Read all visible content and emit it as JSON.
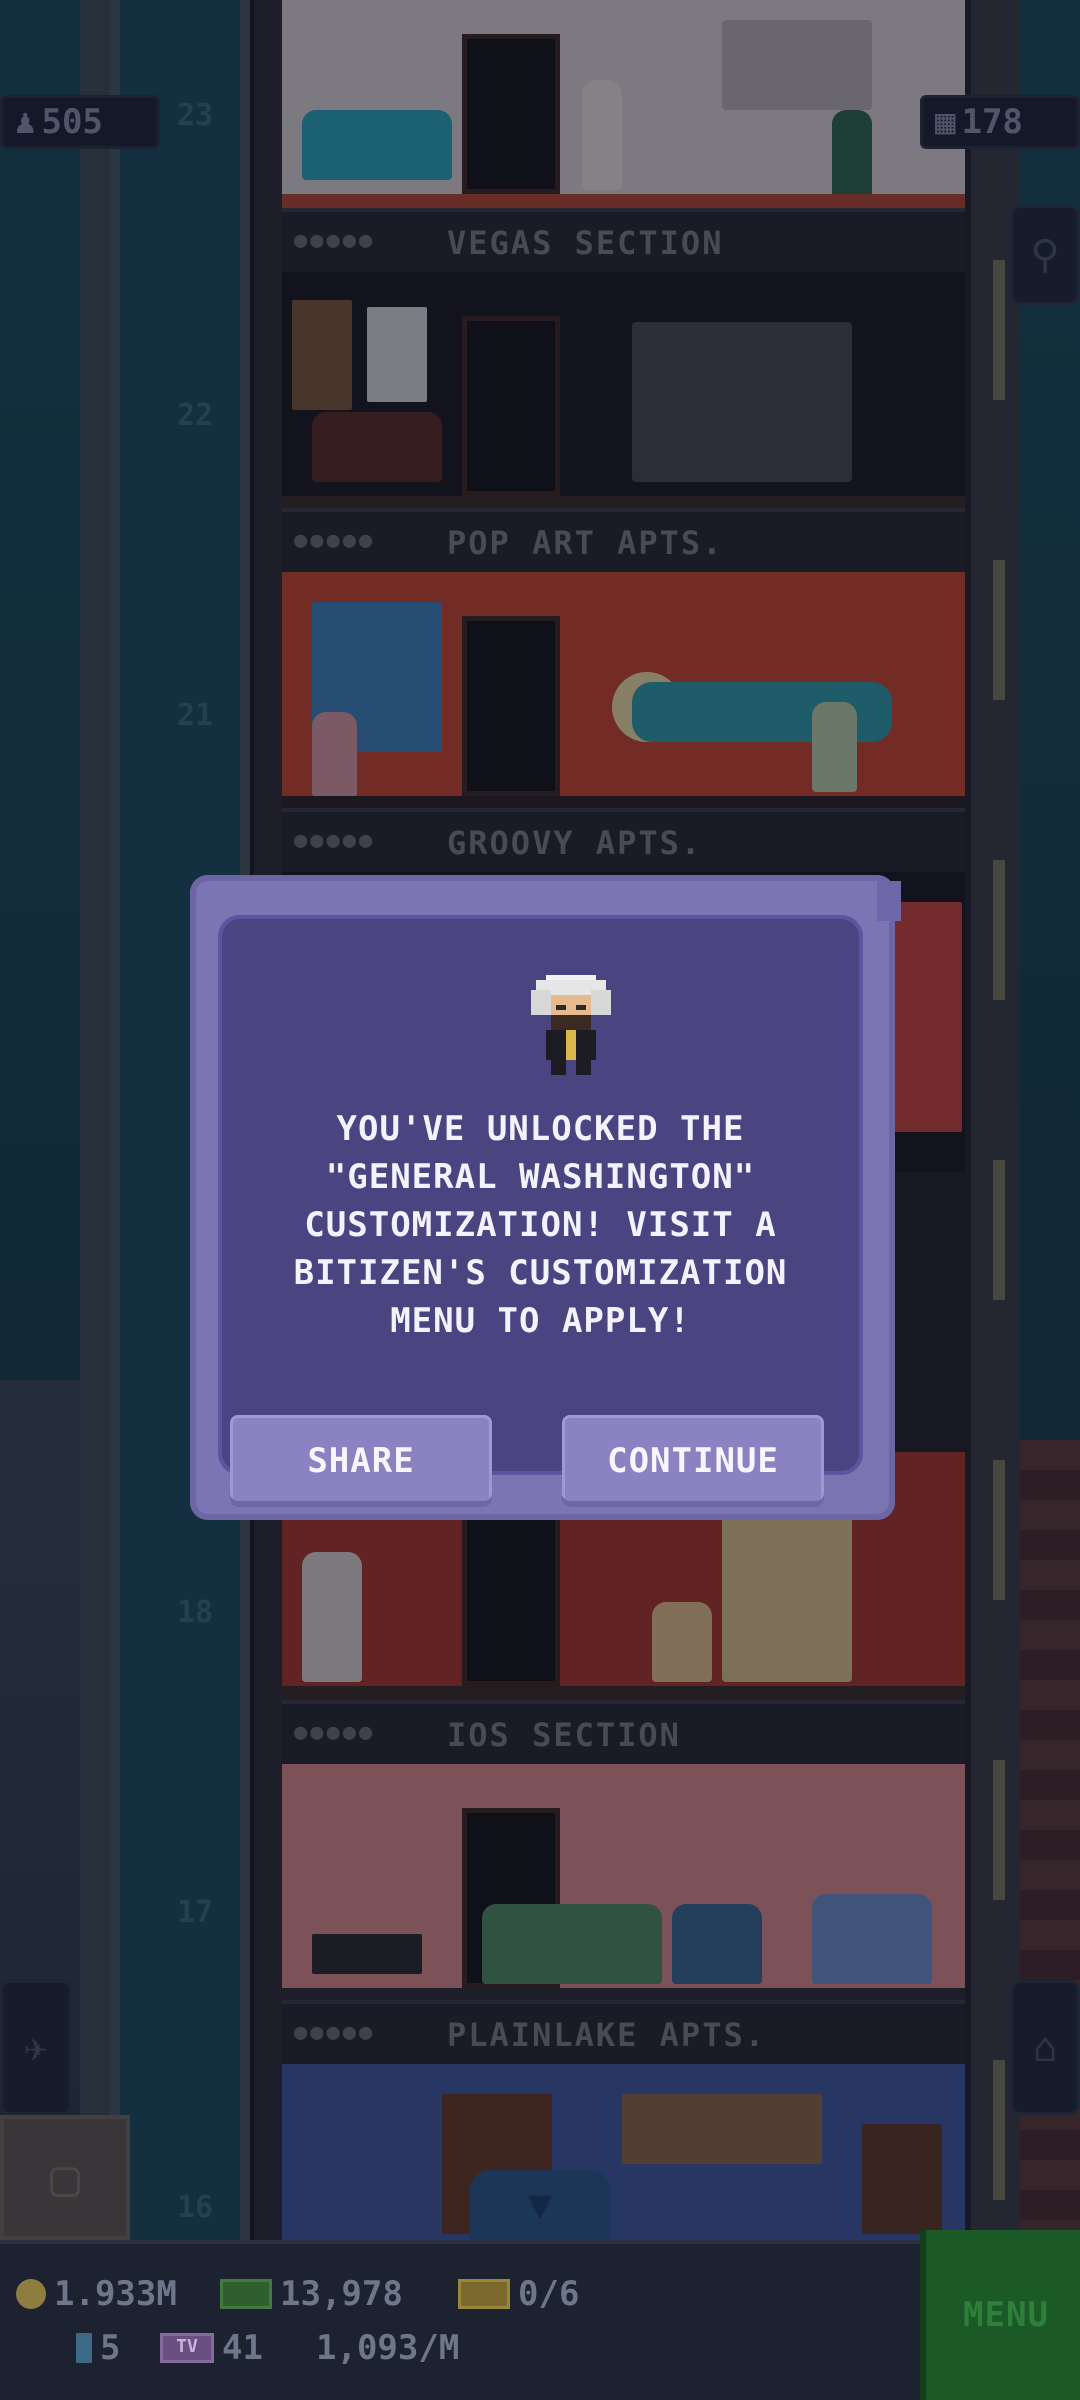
{
  "hud": {
    "population": "505",
    "floors": "178"
  },
  "floors": [
    {
      "number": "23",
      "name": "VEGAS SECTION"
    },
    {
      "number": "22",
      "name": "POP ART APTS."
    },
    {
      "number": "21",
      "name": "GROOVY APTS."
    },
    {
      "number": "18",
      "name": "IOS SECTION"
    },
    {
      "number": "17",
      "name": "PLAINLAKE APTS."
    },
    {
      "number": "16",
      "name": ""
    }
  ],
  "dialog": {
    "message_lines": [
      "YOU'VE UNLOCKED THE",
      "\"GENERAL WASHINGTON\"",
      "CUSTOMIZATION! VISIT A",
      "BITIZEN'S CUSTOMIZATION",
      "MENU TO APPLY!"
    ],
    "share_label": "SHARE",
    "continue_label": "CONTINUE"
  },
  "bottom_bar": {
    "coins": "1.933M",
    "bux": "13,978",
    "tickets": "0/6",
    "vip": "5",
    "tv_icon": "TV",
    "tv_count": "41",
    "income_rate": "1,093/M",
    "menu_label": "MENU"
  },
  "icons": {
    "population": "person-icon",
    "floors": "building-icon",
    "search": "magnifier-icon",
    "home": "home-icon",
    "flight": "airplane-icon",
    "storage": "box-icon",
    "scroll_down": "down-arrow-icon"
  },
  "colors": {
    "dialog_outer": "#7d74b4",
    "dialog_inner": "#4a4481",
    "button": "#8a82c1",
    "menu": "#1b5a26",
    "text": "#f4f2ff"
  }
}
